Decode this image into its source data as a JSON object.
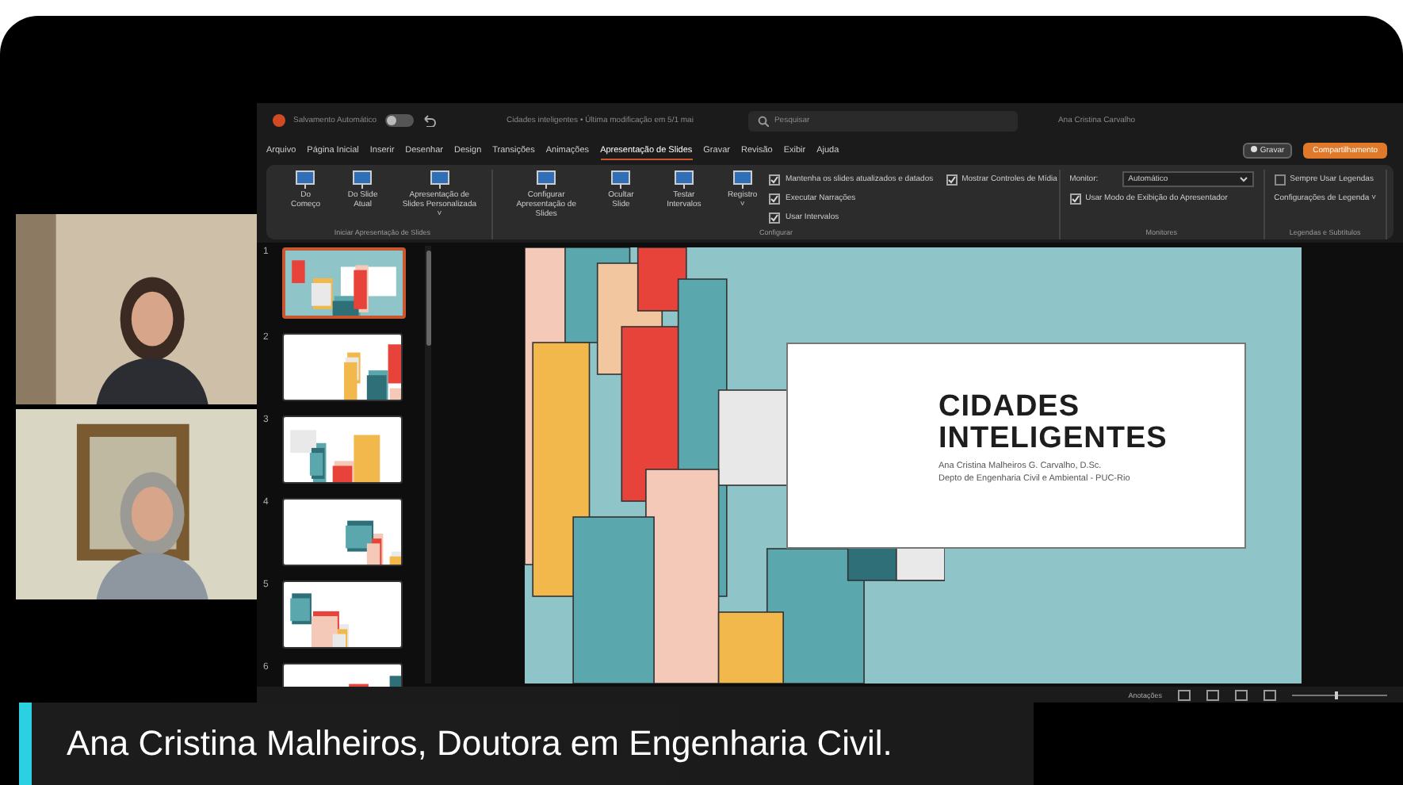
{
  "title_bar": {
    "autosave_label": "Salvamento Automático",
    "autosave_on": false,
    "document_title": "Cidades inteligentes • Última modificação em 5/1 mai",
    "search": {
      "placeholder": "Pesquisar"
    },
    "user": "Ana Cristina Carvalho"
  },
  "menu": [
    {
      "label": "Arquivo",
      "selected": false
    },
    {
      "label": "Página Inicial",
      "selected": false
    },
    {
      "label": "Inserir",
      "selected": false
    },
    {
      "label": "Desenhar",
      "selected": false
    },
    {
      "label": "Design",
      "selected": false
    },
    {
      "label": "Transições",
      "selected": false
    },
    {
      "label": "Animações",
      "selected": false
    },
    {
      "label": "Apresentação de Slides",
      "selected": true
    },
    {
      "label": "Gravar",
      "selected": false
    },
    {
      "label": "Revisão",
      "selected": false
    },
    {
      "label": "Exibir",
      "selected": false
    },
    {
      "label": "Ajuda",
      "selected": false
    }
  ],
  "record_button": "Gravar",
  "share_button": "Compartilhamento",
  "ribbon": [
    {
      "label": "Iniciar Apresentação de Slides",
      "items": [
        {
          "kind": "button",
          "label": "Do Começo"
        },
        {
          "kind": "button",
          "label": "Do Slide Atual"
        },
        {
          "kind": "button",
          "label": "Apresentação de Slides Personalizada ˅"
        }
      ]
    },
    {
      "label": "Configurar",
      "items": [
        {
          "kind": "button",
          "label": "Configurar Apresentação de Slides"
        },
        {
          "kind": "button",
          "label": "Ocultar Slide"
        },
        {
          "kind": "button",
          "label": "Testar Intervalos"
        },
        {
          "kind": "button",
          "label": "Registro ˅"
        },
        {
          "kind": "checkbox",
          "label": "Mantenha os slides atualizados e datados",
          "checked": true
        },
        {
          "kind": "checkbox",
          "label": "Executar Narrações",
          "checked": true
        },
        {
          "kind": "checkbox",
          "label": "Usar Intervalos",
          "checked": true
        },
        {
          "kind": "checkbox",
          "label": "Mostrar Controles de Mídia",
          "checked": true
        }
      ]
    },
    {
      "label": "Monitores",
      "items": [
        {
          "kind": "select",
          "label": "Monitor:",
          "value": "Automático"
        },
        {
          "kind": "checkbox",
          "label": "Usar Modo de Exibição do Apresentador",
          "checked": true
        }
      ]
    },
    {
      "label": "Legendas e Subtítulos",
      "items": [
        {
          "kind": "checkbox",
          "label": "Sempre Usar Legendas",
          "checked": false
        },
        {
          "kind": "small_button",
          "label": "Configurações de Legenda ˅"
        }
      ]
    }
  ],
  "thumbnails": [
    {
      "number": "1",
      "selected": true
    },
    {
      "number": "2",
      "selected": false
    },
    {
      "number": "3",
      "selected": false
    },
    {
      "number": "4",
      "selected": false
    },
    {
      "number": "5",
      "selected": false
    },
    {
      "number": "6",
      "selected": false
    }
  ],
  "slide": {
    "title_lines": [
      "CIDADES",
      "INTELIGENTES"
    ],
    "subtitle_lines": [
      "Ana Cristina Malheiros G. Carvalho, D.Sc.",
      "Depto de Engenharia Civil e Ambiental - PUC-Rio"
    ]
  },
  "status_bar": {
    "notes_button": "Anotações",
    "zoom_slider": {
      "level": 0.45
    }
  },
  "caption": "Ana Cristina Malheiros, Doutora em Engenharia Civil."
}
